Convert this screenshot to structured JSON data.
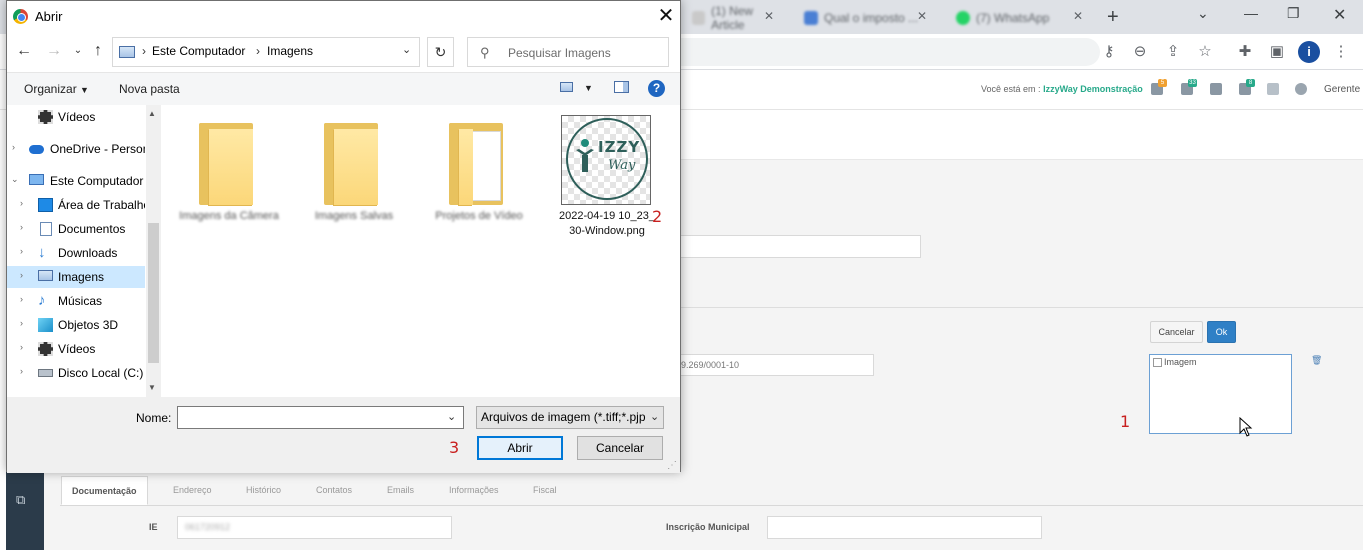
{
  "browser": {
    "tabs": [
      {
        "label": "(1) New Article",
        "icon_color": "#c9c9c9"
      },
      {
        "label": "Qual o imposto ...",
        "icon_color": "#4a7fd4"
      },
      {
        "label": "(7) WhatsApp",
        "icon_color": "#25d366"
      }
    ],
    "new_tab_icon": "plus-icon",
    "avatar_letter": "i",
    "toolbar_icons": [
      "key-icon",
      "zoom-icon",
      "share-icon",
      "star-icon",
      "extensions-icon",
      "sidepanel-icon",
      "menu-icon"
    ]
  },
  "app": {
    "location_prefix": "Você está em :",
    "location_name": "IzzyWay Demonstração",
    "badges": [
      {
        "text": "5",
        "color": "#f0a030"
      },
      {
        "text": "33",
        "color": "#27a98a"
      },
      {
        "text": "",
        "color": ""
      },
      {
        "text": "8",
        "color": "#27a98a"
      }
    ],
    "user_menu": "Gerente",
    "cnpj_value": "9.269/0001-10",
    "cancel_label": "Cancelar",
    "ok_label": "Ok",
    "image_alt": "Imagem",
    "tabs": [
      "Documentação",
      "Endereço",
      "Histórico",
      "Contatos",
      "Emails",
      "Informações",
      "Fiscal"
    ],
    "ie_label": "IE",
    "ie_value": "061720912",
    "municipal_label": "Inscrição Municipal",
    "accent_color": "#2f80c6"
  },
  "annotations": {
    "one": "1",
    "two": "2",
    "three": "3"
  },
  "dialog": {
    "title": "Abrir",
    "breadcrumb": [
      "Este Computador",
      "Imagens"
    ],
    "search_placeholder": "Pesquisar Imagens",
    "organize_label": "Organizar",
    "new_folder_label": "Nova pasta",
    "help_label": "?",
    "nav_tree": [
      {
        "label": "Vídeos",
        "icon": "videos-icon",
        "indent": 1,
        "expandable": false,
        "selected": false
      },
      {
        "label": "OneDrive - Person",
        "icon": "cloud-icon",
        "indent": 0,
        "expandable": true,
        "selected": false
      },
      {
        "label": "Este Computador",
        "icon": "computer-icon",
        "indent": 0,
        "expandable": true,
        "expanded": true,
        "selected": false
      },
      {
        "label": "Área de Trabalho",
        "icon": "desktop-icon",
        "indent": 1,
        "expandable": true,
        "selected": false
      },
      {
        "label": "Documentos",
        "icon": "documents-icon",
        "indent": 1,
        "expandable": true,
        "selected": false
      },
      {
        "label": "Downloads",
        "icon": "downloads-icon",
        "indent": 1,
        "expandable": true,
        "selected": false
      },
      {
        "label": "Imagens",
        "icon": "pictures-icon",
        "indent": 1,
        "expandable": true,
        "selected": true
      },
      {
        "label": "Músicas",
        "icon": "music-icon",
        "indent": 1,
        "expandable": true,
        "selected": false
      },
      {
        "label": "Objetos 3D",
        "icon": "objects3d-icon",
        "indent": 1,
        "expandable": true,
        "selected": false
      },
      {
        "label": "Vídeos",
        "icon": "videos-icon",
        "indent": 1,
        "expandable": true,
        "selected": false
      },
      {
        "label": "Disco Local (C:)",
        "icon": "drive-icon",
        "indent": 1,
        "expandable": true,
        "selected": false
      }
    ],
    "files": [
      {
        "label": "Imagens da Câmera",
        "type": "folder"
      },
      {
        "label": "Imagens Salvas",
        "type": "folder"
      },
      {
        "label": "Projetos de Vídeo",
        "type": "folder"
      },
      {
        "label": "2022-04-19 10_23_30-Window.png",
        "type": "image",
        "thumb_text": "IZZY",
        "thumb_text2": "Way"
      }
    ],
    "name_label": "Nome:",
    "name_value": "",
    "file_type_filter": "Arquivos de imagem (*.tiff;*.pjp",
    "open_label": "Abrir",
    "cancel_label": "Cancelar"
  }
}
